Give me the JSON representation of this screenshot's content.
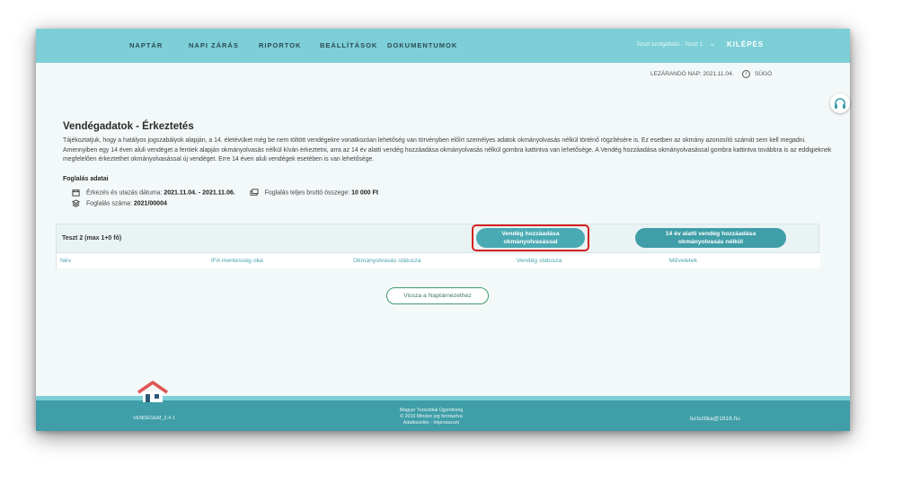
{
  "nav": {
    "items": [
      "NAPTÁR",
      "NAPI ZÁRÁS",
      "RIPORTOK",
      "BEÁLLÍTÁSOK",
      "DOKUMENTUMOK"
    ],
    "user": "Teszt szolgáltató - Teszt 1",
    "logout": "KILÉPÉS"
  },
  "status": {
    "closing_day": "LEZÁRANDÓ NAP: 2021.11.04.",
    "help": "SÚGÓ"
  },
  "page": {
    "title": "Vendégadatok - Érkeztetés",
    "info": "Tájékoztatjuk, hogy a hatályos jogszabályok alapján, a 14. életévüket még be nem töltött vendégekre vonatkozóan lehetőség van törvényben előírt személyes adatok okmányolvasás nélkül történő rögzítésére is. Ez esetben az okmány azonosító számát sem kell megadni. Amennyiben egy 14 éven aluli vendéget a fentiek alapján okmányolvasás nélkül kíván érkeztetni, arra az 14 év alatti vendég hozzáadása okmányolvasás nélkül gombra kattintva van lehetősége. A Vendég hozzáadása okmányolvasással gombra kattintva továbbra is az eddigieknek megfelelően érkeztethet okmányolvasással új vendéget. Erre 14 éven aluli vendégek esetében is van lehetősége."
  },
  "booking": {
    "section_label": "Foglalás adatai",
    "dates_label": "Érkezés és utazás dátuma:",
    "dates_value": "2021.11.04. - 2021.11.06.",
    "total_label": "Foglalás teljes bruttó összege:",
    "total_value": "10 000 Ft",
    "number_label": "Foglalás száma:",
    "number_value": "2021/00004"
  },
  "guests": {
    "header": "Teszt 2 (max 1+0 fő)",
    "add_with_doc_line1": "Vendég hozzáadása",
    "add_with_doc_line2": "okmányolvasással",
    "add_without_doc_line1": "14 év alatti vendég hozzáadása",
    "add_without_doc_line2": "okmányolvasás nélkül",
    "columns": [
      "Név",
      "IFA mentesség oka",
      "Okmányolvasás státusza",
      "Vendég státusza",
      "Műveletek"
    ]
  },
  "back_button": "Vissza a Naptárnézethez",
  "footer": {
    "version": "VENDÉGEM_2.4.1",
    "line1": "Magyar Turisztikai Ügynökség",
    "line2": "© 2019 Minden jog fenntartva",
    "line3": "Adatkezelés - Impresszum",
    "email": "turisztika@1818.hu"
  },
  "colors": {
    "nav_bg": "#7ccfd6",
    "button_bg": "#4aaab3",
    "footer_bg": "#3f9ea8",
    "highlight": "#d61f1f"
  }
}
